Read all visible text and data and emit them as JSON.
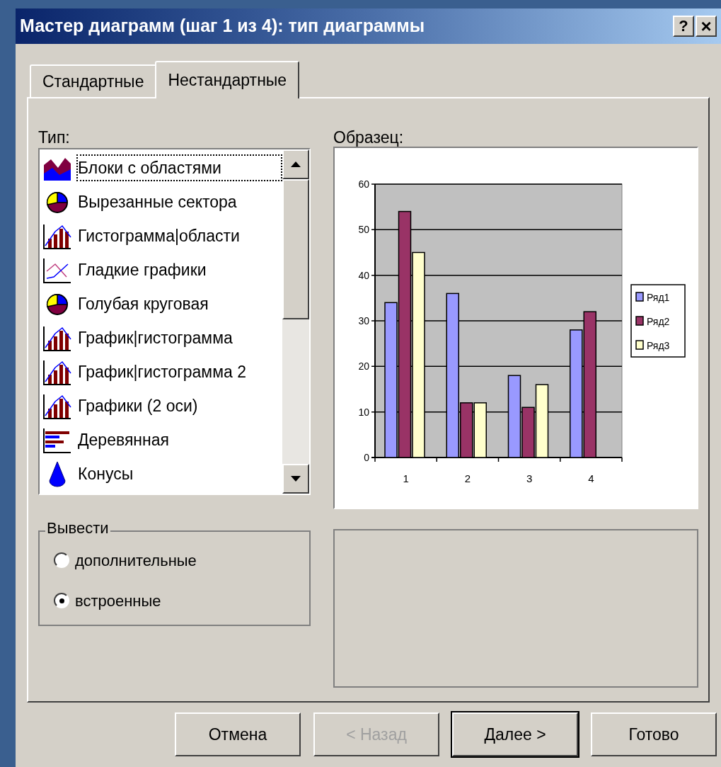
{
  "window": {
    "title": "Мастер диаграмм (шаг 1 из 4): тип диаграммы",
    "help_button": "?",
    "close_button": "×"
  },
  "tabs": [
    {
      "label": "Стандартные",
      "selected": false
    },
    {
      "label": "Нестандартные",
      "selected": true
    }
  ],
  "type_list": {
    "label": "Тип:",
    "items": [
      {
        "label": "Блоки с областями",
        "kind": "area",
        "selected": true
      },
      {
        "label": "Вырезанные сектора",
        "kind": "pie",
        "selected": false
      },
      {
        "label": "Гистограмма|области",
        "kind": "combo",
        "selected": false
      },
      {
        "label": "Гладкие графики",
        "kind": "line",
        "selected": false
      },
      {
        "label": "Голубая круговая",
        "kind": "pie",
        "selected": false
      },
      {
        "label": "График|гистограмма",
        "kind": "combo",
        "selected": false
      },
      {
        "label": "График|гистограмма 2",
        "kind": "combo",
        "selected": false
      },
      {
        "label": "Графики (2 оси)",
        "kind": "combo",
        "selected": false
      },
      {
        "label": "Деревянная",
        "kind": "hbar",
        "selected": false
      },
      {
        "label": "Конусы",
        "kind": "cone",
        "selected": false
      }
    ]
  },
  "preview": {
    "label": "Образец:",
    "chart_data": {
      "type": "bar",
      "grid": true,
      "legend": "right",
      "categories": [
        "1",
        "2",
        "3",
        "4"
      ],
      "ylim": [
        0,
        60
      ],
      "yticks": [
        0,
        10,
        20,
        30,
        40,
        50,
        60
      ],
      "series": [
        {
          "name": "Ряд1",
          "color": "#9999ff",
          "values": [
            34,
            36,
            18,
            28
          ]
        },
        {
          "name": "Ряд2",
          "color": "#993366",
          "values": [
            54,
            12,
            11,
            32
          ]
        },
        {
          "name": "Ряд3",
          "color": "#ffffcc",
          "values": [
            45,
            12,
            16,
            null
          ]
        }
      ]
    }
  },
  "show_group": {
    "label": "Вывести",
    "options": [
      {
        "label": "дополнительные",
        "selected": false
      },
      {
        "label": "встроенные",
        "selected": true
      }
    ]
  },
  "buttons": [
    {
      "label": "Отмена",
      "disabled": false,
      "default": false
    },
    {
      "label": "< Назад",
      "disabled": true,
      "default": false
    },
    {
      "label": "Далее >",
      "disabled": false,
      "default": true
    },
    {
      "label": "Готово",
      "disabled": false,
      "default": false
    }
  ]
}
